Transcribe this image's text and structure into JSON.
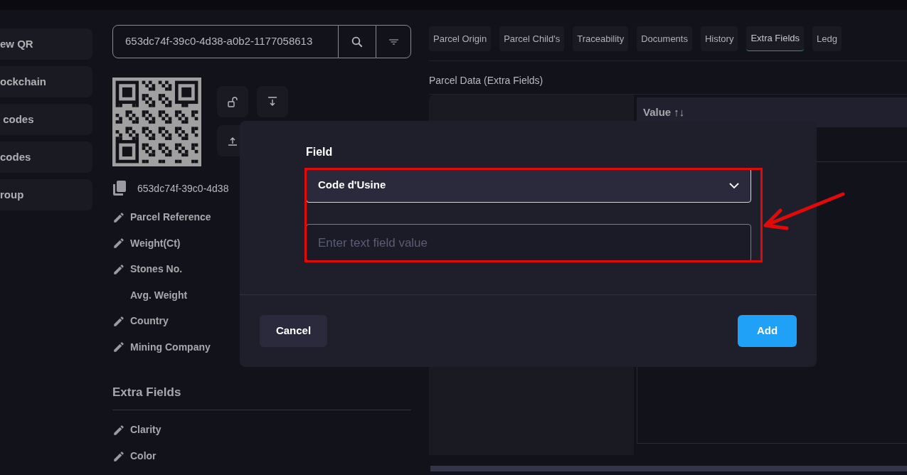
{
  "sidebar": {
    "items": [
      {
        "label": "ew QR"
      },
      {
        "label": "ockchain"
      },
      {
        "label": " codes"
      },
      {
        "label": "codes"
      },
      {
        "label": "roup"
      }
    ]
  },
  "search": {
    "value": "653dc74f-39c0-4d38-a0b2-1177058613"
  },
  "parcel_id": "653dc74f-39c0-4d38",
  "fields": [
    {
      "label": "Parcel Reference",
      "editable": true
    },
    {
      "label": "Weight(Ct)",
      "editable": true
    },
    {
      "label": "Stones No.",
      "editable": true
    },
    {
      "label": "Avg. Weight",
      "editable": false
    },
    {
      "label": "Country",
      "editable": true
    },
    {
      "label": "Mining Company",
      "editable": true
    }
  ],
  "extra_fields": {
    "title": "Extra Fields",
    "items": [
      {
        "label": "Clarity",
        "editable": true
      },
      {
        "label": "Color",
        "editable": true
      }
    ]
  },
  "tabs": [
    {
      "label": "Parcel Origin",
      "selected": false
    },
    {
      "label": "Parcel Child's",
      "selected": false
    },
    {
      "label": "Traceability",
      "selected": false
    },
    {
      "label": "Documents",
      "selected": false
    },
    {
      "label": "History",
      "selected": false
    },
    {
      "label": "Extra Fields",
      "selected": true
    },
    {
      "label": "Ledg",
      "selected": false
    }
  ],
  "section_title": "Parcel Data (Extra Fields)",
  "table": {
    "columns": [
      "Value ↑↓"
    ]
  },
  "dialog": {
    "label": "Field",
    "select_value": "Code d'Usine",
    "placeholder": "Enter text field value",
    "cancel": "Cancel",
    "confirm": "Add"
  }
}
